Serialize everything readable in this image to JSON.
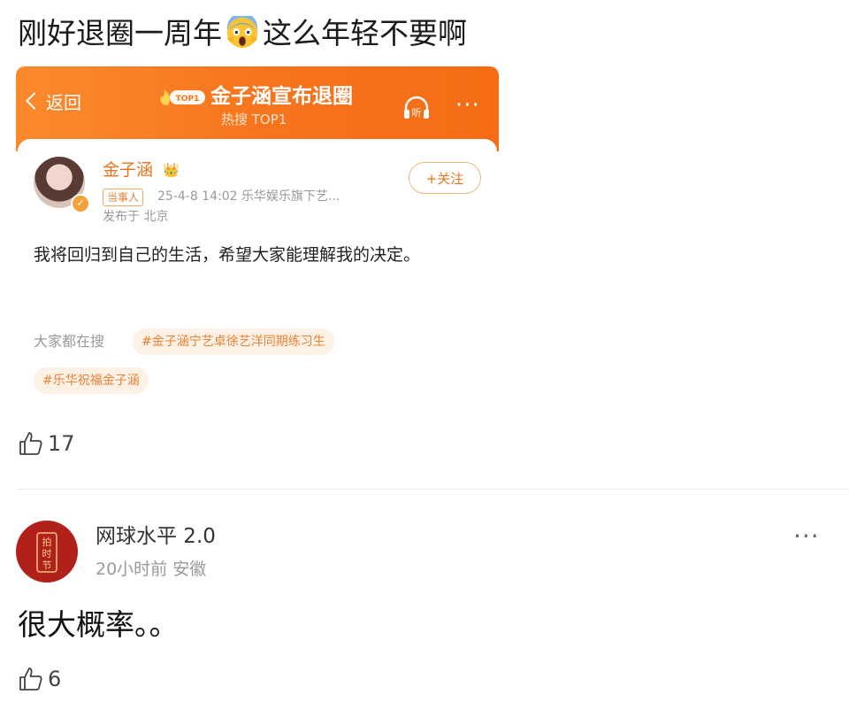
{
  "comment1": {
    "text_before": "刚好退圈一周年",
    "emoji": "screaming-face-emoji",
    "text_after": "这么年轻不要啊",
    "likes": "17"
  },
  "screenshot": {
    "back_label": "返回",
    "top_badge": "TOP1",
    "topic_title": "金子涵宣布退圈",
    "topic_sub": "热搜 TOP1",
    "listen_label": "听",
    "more": "···",
    "post": {
      "username": "金子涵",
      "party_tag": "当事人",
      "meta": "25-4-8 14:02  乐华娱乐旗下艺...",
      "location": "发布于 北京",
      "follow_label": "+关注",
      "text": "我将回归到自己的生活，希望大家能理解我的决定。",
      "search_label": "大家都在搜",
      "hashtags": [
        "#金子涵宁艺卓徐艺洋同期练习生",
        "#乐华祝福金子涵"
      ]
    }
  },
  "comment2": {
    "username": "网球水平 2.0",
    "meta": "20小时前  安徽",
    "more": "···",
    "text": "很大概率。。",
    "likes": "6",
    "avatar_text": [
      "拍",
      "时",
      "节"
    ]
  },
  "colors": {
    "header_orange": "#f7731c",
    "accent_orange": "#e8731d",
    "hashtag_bg": "#fdf0e4",
    "avatar_red": "#b2201c"
  }
}
